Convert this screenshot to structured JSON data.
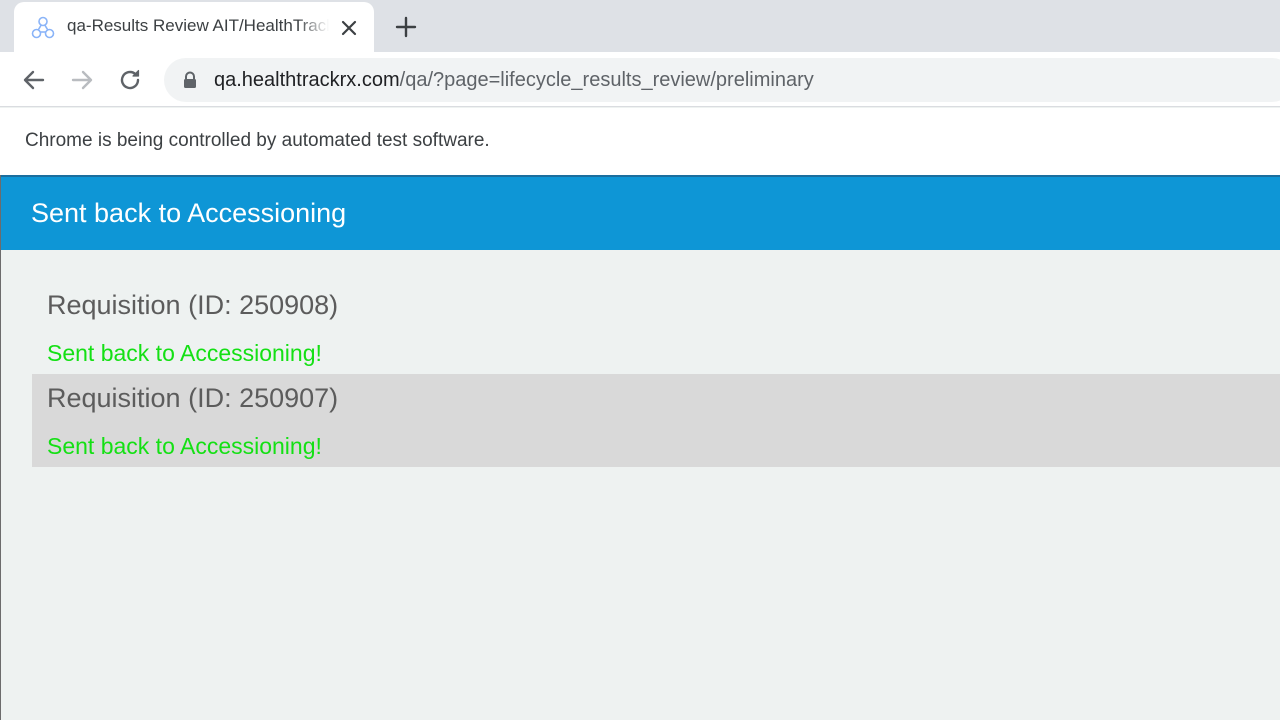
{
  "browser": {
    "tab": {
      "title": "qa-Results Review AIT/HealthTrackRx",
      "favicon": "molecule-icon"
    },
    "url": {
      "host": "qa.healthtrackrx.com",
      "path": "/qa/?page=lifecycle_results_review/preliminary"
    },
    "automation_notice": "Chrome is being controlled by automated test software."
  },
  "page": {
    "title": "Sent back to Accessioning",
    "requisitions": [
      {
        "title": "Requisition (ID: 250908)",
        "status": "Sent back to Accessioning!"
      },
      {
        "title": "Requisition (ID: 250907)",
        "status": "Sent back to Accessioning!"
      }
    ]
  },
  "colors": {
    "header": "#0e96d6",
    "status_success": "#14e014",
    "alt_row": "#d9d9d9",
    "page_background": "#eef2f1"
  }
}
